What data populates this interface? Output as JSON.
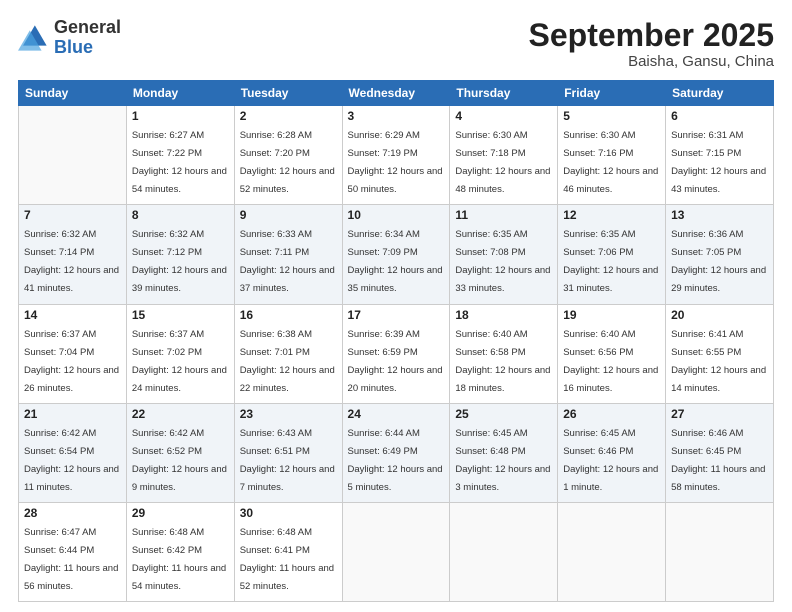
{
  "logo": {
    "general": "General",
    "blue": "Blue"
  },
  "header": {
    "month": "September 2025",
    "location": "Baisha, Gansu, China"
  },
  "weekdays": [
    "Sunday",
    "Monday",
    "Tuesday",
    "Wednesday",
    "Thursday",
    "Friday",
    "Saturday"
  ],
  "weeks": [
    [
      {
        "day": "",
        "empty": true
      },
      {
        "day": "1",
        "sunrise": "Sunrise: 6:27 AM",
        "sunset": "Sunset: 7:22 PM",
        "daylight": "Daylight: 12 hours and 54 minutes."
      },
      {
        "day": "2",
        "sunrise": "Sunrise: 6:28 AM",
        "sunset": "Sunset: 7:20 PM",
        "daylight": "Daylight: 12 hours and 52 minutes."
      },
      {
        "day": "3",
        "sunrise": "Sunrise: 6:29 AM",
        "sunset": "Sunset: 7:19 PM",
        "daylight": "Daylight: 12 hours and 50 minutes."
      },
      {
        "day": "4",
        "sunrise": "Sunrise: 6:30 AM",
        "sunset": "Sunset: 7:18 PM",
        "daylight": "Daylight: 12 hours and 48 minutes."
      },
      {
        "day": "5",
        "sunrise": "Sunrise: 6:30 AM",
        "sunset": "Sunset: 7:16 PM",
        "daylight": "Daylight: 12 hours and 46 minutes."
      },
      {
        "day": "6",
        "sunrise": "Sunrise: 6:31 AM",
        "sunset": "Sunset: 7:15 PM",
        "daylight": "Daylight: 12 hours and 43 minutes."
      }
    ],
    [
      {
        "day": "7",
        "sunrise": "Sunrise: 6:32 AM",
        "sunset": "Sunset: 7:14 PM",
        "daylight": "Daylight: 12 hours and 41 minutes."
      },
      {
        "day": "8",
        "sunrise": "Sunrise: 6:32 AM",
        "sunset": "Sunset: 7:12 PM",
        "daylight": "Daylight: 12 hours and 39 minutes."
      },
      {
        "day": "9",
        "sunrise": "Sunrise: 6:33 AM",
        "sunset": "Sunset: 7:11 PM",
        "daylight": "Daylight: 12 hours and 37 minutes."
      },
      {
        "day": "10",
        "sunrise": "Sunrise: 6:34 AM",
        "sunset": "Sunset: 7:09 PM",
        "daylight": "Daylight: 12 hours and 35 minutes."
      },
      {
        "day": "11",
        "sunrise": "Sunrise: 6:35 AM",
        "sunset": "Sunset: 7:08 PM",
        "daylight": "Daylight: 12 hours and 33 minutes."
      },
      {
        "day": "12",
        "sunrise": "Sunrise: 6:35 AM",
        "sunset": "Sunset: 7:06 PM",
        "daylight": "Daylight: 12 hours and 31 minutes."
      },
      {
        "day": "13",
        "sunrise": "Sunrise: 6:36 AM",
        "sunset": "Sunset: 7:05 PM",
        "daylight": "Daylight: 12 hours and 29 minutes."
      }
    ],
    [
      {
        "day": "14",
        "sunrise": "Sunrise: 6:37 AM",
        "sunset": "Sunset: 7:04 PM",
        "daylight": "Daylight: 12 hours and 26 minutes."
      },
      {
        "day": "15",
        "sunrise": "Sunrise: 6:37 AM",
        "sunset": "Sunset: 7:02 PM",
        "daylight": "Daylight: 12 hours and 24 minutes."
      },
      {
        "day": "16",
        "sunrise": "Sunrise: 6:38 AM",
        "sunset": "Sunset: 7:01 PM",
        "daylight": "Daylight: 12 hours and 22 minutes."
      },
      {
        "day": "17",
        "sunrise": "Sunrise: 6:39 AM",
        "sunset": "Sunset: 6:59 PM",
        "daylight": "Daylight: 12 hours and 20 minutes."
      },
      {
        "day": "18",
        "sunrise": "Sunrise: 6:40 AM",
        "sunset": "Sunset: 6:58 PM",
        "daylight": "Daylight: 12 hours and 18 minutes."
      },
      {
        "day": "19",
        "sunrise": "Sunrise: 6:40 AM",
        "sunset": "Sunset: 6:56 PM",
        "daylight": "Daylight: 12 hours and 16 minutes."
      },
      {
        "day": "20",
        "sunrise": "Sunrise: 6:41 AM",
        "sunset": "Sunset: 6:55 PM",
        "daylight": "Daylight: 12 hours and 14 minutes."
      }
    ],
    [
      {
        "day": "21",
        "sunrise": "Sunrise: 6:42 AM",
        "sunset": "Sunset: 6:54 PM",
        "daylight": "Daylight: 12 hours and 11 minutes."
      },
      {
        "day": "22",
        "sunrise": "Sunrise: 6:42 AM",
        "sunset": "Sunset: 6:52 PM",
        "daylight": "Daylight: 12 hours and 9 minutes."
      },
      {
        "day": "23",
        "sunrise": "Sunrise: 6:43 AM",
        "sunset": "Sunset: 6:51 PM",
        "daylight": "Daylight: 12 hours and 7 minutes."
      },
      {
        "day": "24",
        "sunrise": "Sunrise: 6:44 AM",
        "sunset": "Sunset: 6:49 PM",
        "daylight": "Daylight: 12 hours and 5 minutes."
      },
      {
        "day": "25",
        "sunrise": "Sunrise: 6:45 AM",
        "sunset": "Sunset: 6:48 PM",
        "daylight": "Daylight: 12 hours and 3 minutes."
      },
      {
        "day": "26",
        "sunrise": "Sunrise: 6:45 AM",
        "sunset": "Sunset: 6:46 PM",
        "daylight": "Daylight: 12 hours and 1 minute."
      },
      {
        "day": "27",
        "sunrise": "Sunrise: 6:46 AM",
        "sunset": "Sunset: 6:45 PM",
        "daylight": "Daylight: 11 hours and 58 minutes."
      }
    ],
    [
      {
        "day": "28",
        "sunrise": "Sunrise: 6:47 AM",
        "sunset": "Sunset: 6:44 PM",
        "daylight": "Daylight: 11 hours and 56 minutes."
      },
      {
        "day": "29",
        "sunrise": "Sunrise: 6:48 AM",
        "sunset": "Sunset: 6:42 PM",
        "daylight": "Daylight: 11 hours and 54 minutes."
      },
      {
        "day": "30",
        "sunrise": "Sunrise: 6:48 AM",
        "sunset": "Sunset: 6:41 PM",
        "daylight": "Daylight: 11 hours and 52 minutes."
      },
      {
        "day": "",
        "empty": true
      },
      {
        "day": "",
        "empty": true
      },
      {
        "day": "",
        "empty": true
      },
      {
        "day": "",
        "empty": true
      }
    ]
  ]
}
